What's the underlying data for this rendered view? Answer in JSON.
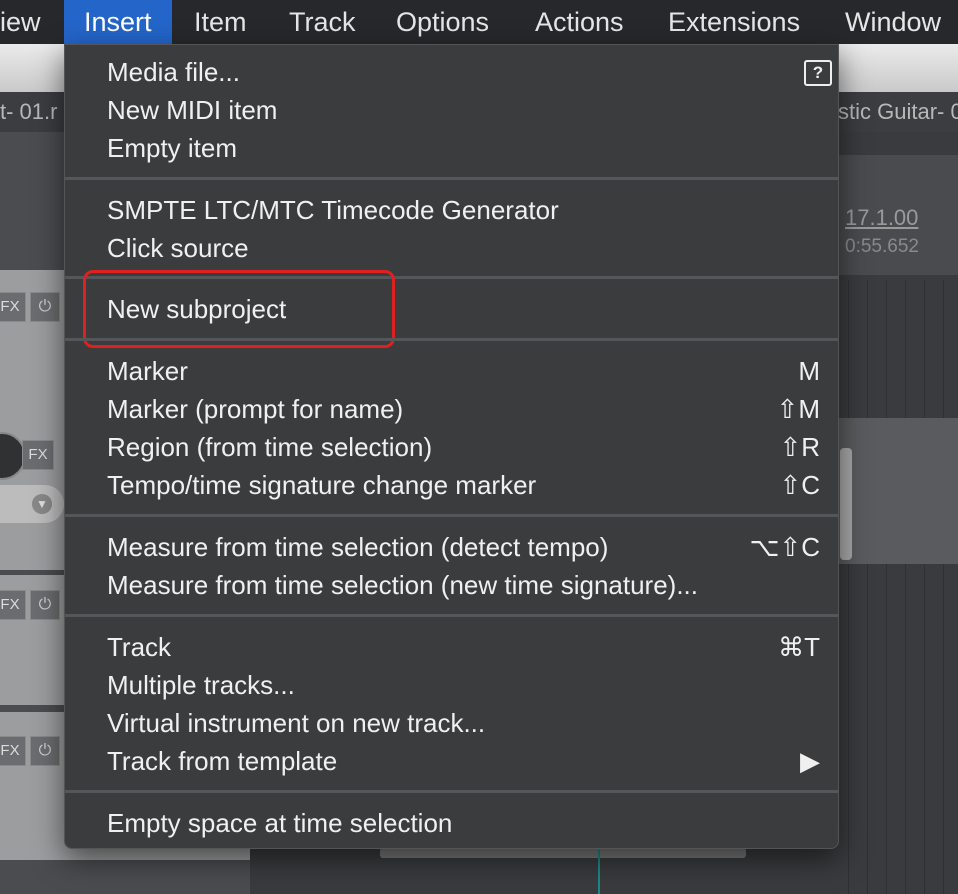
{
  "menubar": {
    "items": [
      "iew",
      "Insert",
      "Item",
      "Track",
      "Options",
      "Actions",
      "Extensions",
      "Window"
    ]
  },
  "background": {
    "tab_left": "t- 01.r",
    "tab_right": "stic Guitar- 0",
    "ruler_measure": "17.1.00",
    "ruler_time": "0:55.652",
    "fx_label": "FX"
  },
  "insert_menu": {
    "help_icon": "?",
    "items": [
      {
        "label": "Media file...",
        "shortcut": ""
      },
      {
        "label": "New MIDI item",
        "shortcut": ""
      },
      {
        "label": "Empty item",
        "shortcut": ""
      },
      {
        "label": "SMPTE LTC/MTC Timecode Generator",
        "shortcut": ""
      },
      {
        "label": "Click source",
        "shortcut": ""
      },
      {
        "label": "New subproject",
        "shortcut": ""
      },
      {
        "label": "Marker",
        "shortcut": "M"
      },
      {
        "label": "Marker (prompt for name)",
        "shortcut": "⇧M"
      },
      {
        "label": "Region (from time selection)",
        "shortcut": "⇧R"
      },
      {
        "label": "Tempo/time signature change marker",
        "shortcut": "⇧C"
      },
      {
        "label": "Measure from time selection (detect tempo)",
        "shortcut": "⌥⇧C"
      },
      {
        "label": "Measure from time selection (new time signature)...",
        "shortcut": ""
      },
      {
        "label": "Track",
        "shortcut": "⌘T"
      },
      {
        "label": "Multiple tracks...",
        "shortcut": ""
      },
      {
        "label": "Virtual instrument on new track...",
        "shortcut": ""
      },
      {
        "label": "Track from template",
        "shortcut": "▶"
      },
      {
        "label": "Empty space at time selection",
        "shortcut": ""
      }
    ]
  },
  "colors": {
    "menu_bg": "#3b3c3e",
    "menubar_active": "#2465c9",
    "highlight": "#e02020"
  }
}
